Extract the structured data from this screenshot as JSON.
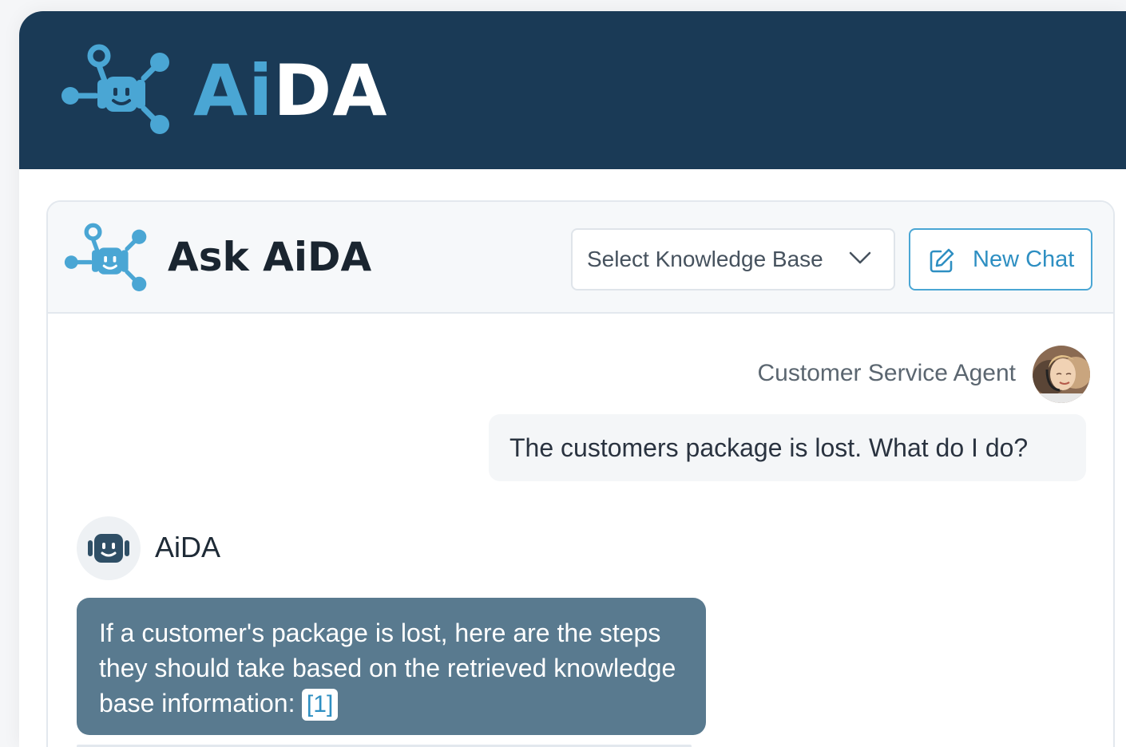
{
  "header": {
    "brand_ai": "Ai",
    "brand_da": "DA",
    "logo_icon": "robot-network-icon"
  },
  "card": {
    "title": "Ask AiDA",
    "logo_icon": "robot-network-icon",
    "kb_select": {
      "label": "Select Knowledge Base",
      "icon": "chevron-down-icon"
    },
    "new_chat": {
      "label": "New Chat",
      "icon": "edit-icon"
    }
  },
  "messages": {
    "user": {
      "name": "Customer Service Agent",
      "text": "The customers package is lost. What do I do?",
      "avatar": "user-avatar"
    },
    "bot": {
      "name": "AiDA",
      "text": "If a customer's package is lost, here are the steps they should take based on the retrieved knowledge base information:",
      "citation": "[1]",
      "avatar_icon": "robot-icon"
    }
  },
  "colors": {
    "header_bg": "#1a3a56",
    "accent": "#4aa6d4",
    "bot_bubble": "#597a8f",
    "user_bubble": "#f4f6f8"
  }
}
